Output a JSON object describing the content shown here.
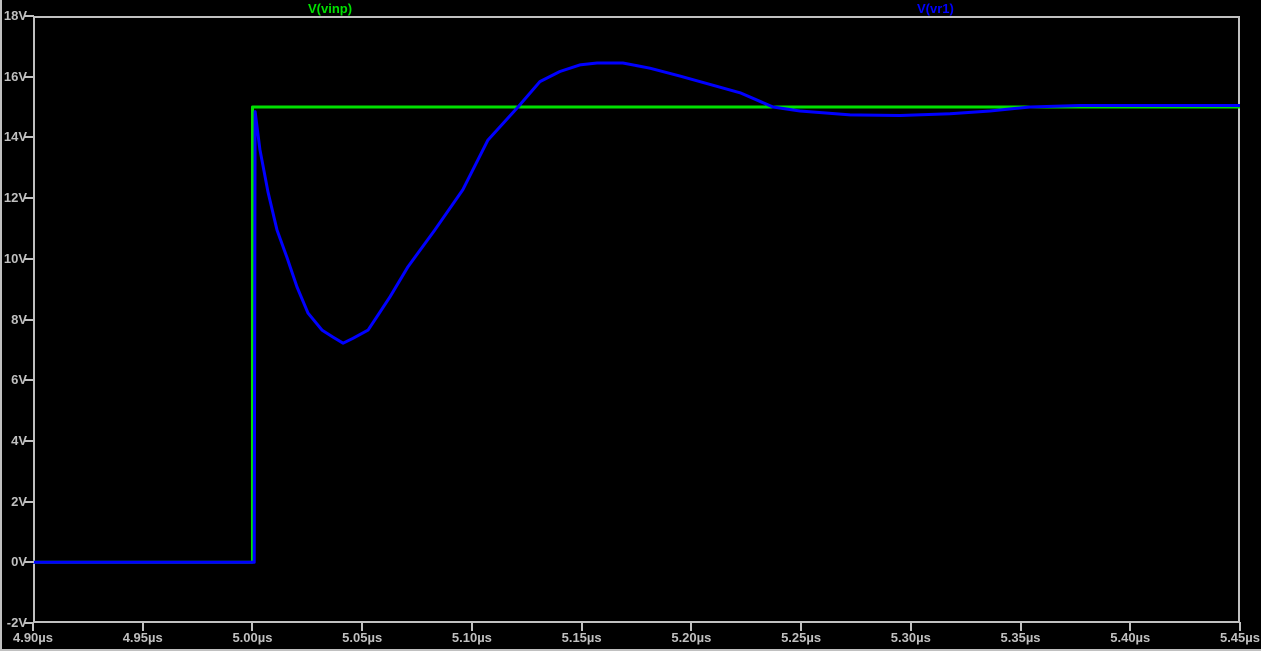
{
  "colors": {
    "background": "#000000",
    "axis": "#c0c0c0"
  },
  "chart_data": {
    "type": "line",
    "title": "",
    "xlabel": "",
    "ylabel": "",
    "grid": false,
    "legend_position": "top",
    "x_axis": {
      "min": 4.9,
      "max": 5.45,
      "unit": "µs",
      "tick_step": 0.05,
      "tick_labels": [
        "4.90µs",
        "4.95µs",
        "5.00µs",
        "5.05µs",
        "5.10µs",
        "5.15µs",
        "5.20µs",
        "5.25µs",
        "5.30µs",
        "5.35µs",
        "5.40µs",
        "5.45µs"
      ]
    },
    "y_axis": {
      "min": -2,
      "max": 18,
      "unit": "V",
      "tick_step": 2,
      "tick_labels": [
        "18V",
        "16V",
        "14V",
        "12V",
        "10V",
        "8V",
        "6V",
        "4V",
        "2V",
        "0V",
        "-2V"
      ]
    },
    "series": [
      {
        "name": "V(vinp)",
        "color": "#00e000",
        "points": [
          [
            4.9,
            0
          ],
          [
            5.0,
            0
          ],
          [
            5.0,
            15
          ],
          [
            5.45,
            15
          ]
        ]
      },
      {
        "name": "V(vr1)",
        "color": "#0000ff",
        "points": [
          [
            4.9,
            0
          ],
          [
            5.0008,
            0
          ],
          [
            5.0012,
            14.85
          ],
          [
            5.0034,
            13.6
          ],
          [
            5.0071,
            12.2
          ],
          [
            5.0112,
            10.95
          ],
          [
            5.0157,
            10.05
          ],
          [
            5.0203,
            9.07
          ],
          [
            5.0253,
            8.21
          ],
          [
            5.0317,
            7.65
          ],
          [
            5.0367,
            7.42
          ],
          [
            5.0413,
            7.22
          ],
          [
            5.0458,
            7.38
          ],
          [
            5.0527,
            7.65
          ],
          [
            5.0627,
            8.75
          ],
          [
            5.0709,
            9.74
          ],
          [
            5.0832,
            10.96
          ],
          [
            5.0959,
            12.28
          ],
          [
            5.1073,
            13.91
          ],
          [
            5.121,
            15.0
          ],
          [
            5.131,
            15.84
          ],
          [
            5.1401,
            16.17
          ],
          [
            5.1492,
            16.39
          ],
          [
            5.157,
            16.45
          ],
          [
            5.1688,
            16.45
          ],
          [
            5.1811,
            16.28
          ],
          [
            5.1948,
            16.02
          ],
          [
            5.2222,
            15.47
          ],
          [
            5.2372,
            15.0
          ],
          [
            5.2495,
            14.87
          ],
          [
            5.2723,
            14.74
          ],
          [
            5.2951,
            14.72
          ],
          [
            5.3179,
            14.78
          ],
          [
            5.3361,
            14.87
          ],
          [
            5.3543,
            15.0
          ],
          [
            5.3771,
            15.05
          ],
          [
            5.45,
            15.05
          ]
        ]
      }
    ]
  }
}
